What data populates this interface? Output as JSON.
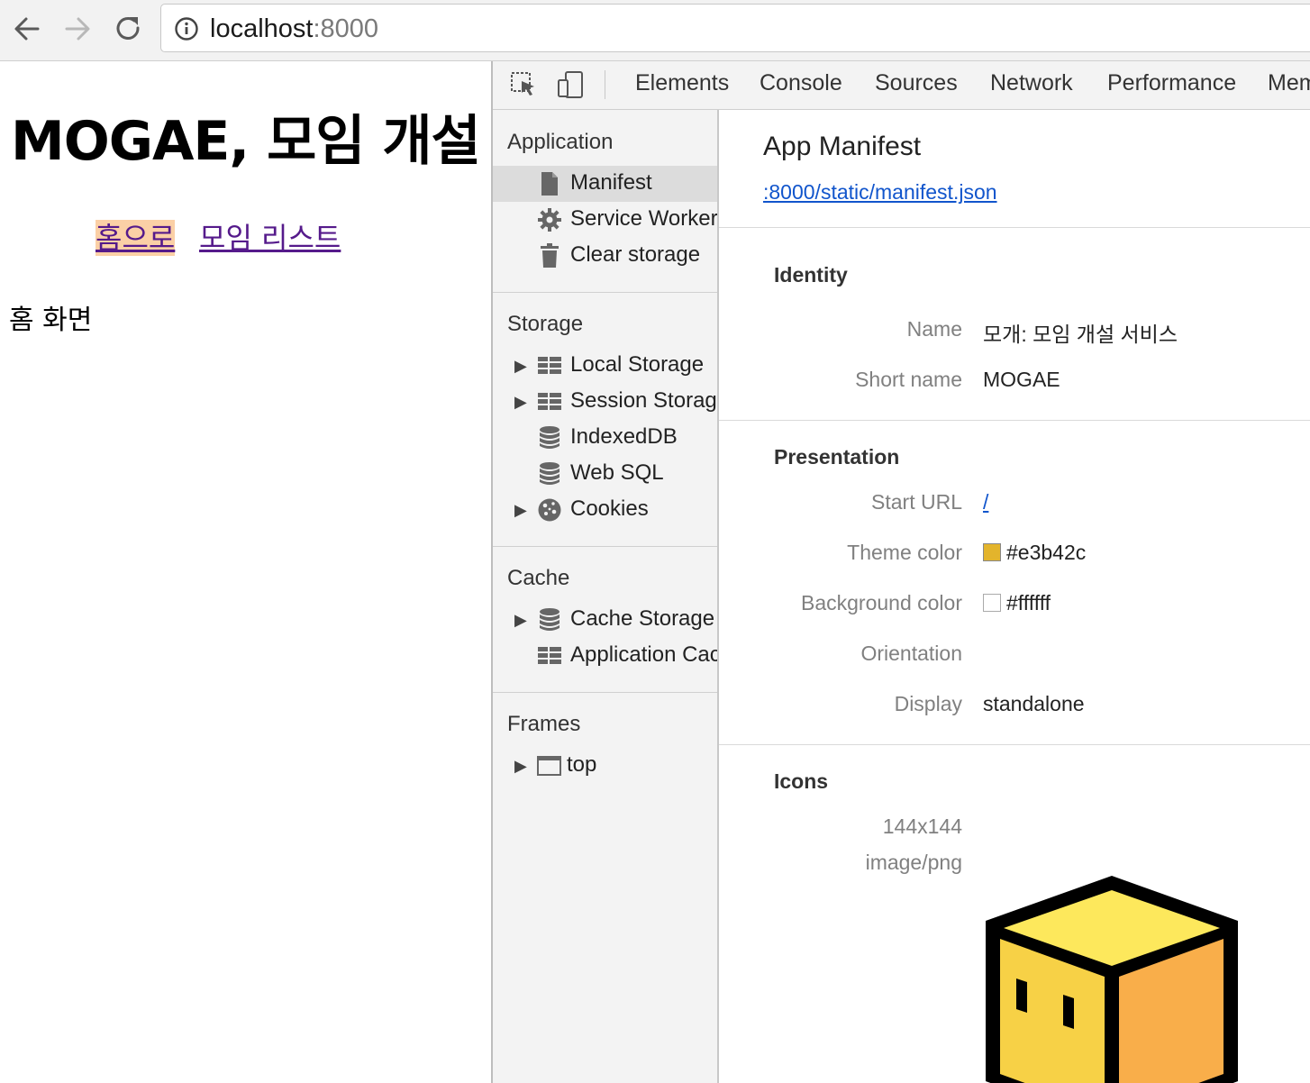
{
  "browser": {
    "url_host": "localhost",
    "url_port": ":8000"
  },
  "page": {
    "title": "MOGAE, 모임 개설",
    "links": [
      "홈으로",
      "모임 리스트"
    ],
    "body_text": "홈 화면"
  },
  "devtools": {
    "tabs": [
      "Elements",
      "Console",
      "Sources",
      "Network",
      "Performance",
      "Mem"
    ],
    "sidebar": {
      "application": {
        "title": "Application",
        "items": [
          "Manifest",
          "Service Workers",
          "Clear storage"
        ]
      },
      "storage": {
        "title": "Storage",
        "items": [
          "Local Storage",
          "Session Storage",
          "IndexedDB",
          "Web SQL",
          "Cookies"
        ]
      },
      "cache": {
        "title": "Cache",
        "items": [
          "Cache Storage",
          "Application Cache"
        ]
      },
      "frames": {
        "title": "Frames",
        "items": [
          "top"
        ]
      }
    },
    "manifest": {
      "title": "App Manifest",
      "link": ":8000/static/manifest.json",
      "identity": {
        "title": "Identity",
        "name_label": "Name",
        "name_value": "모개: 모임 개설 서비스",
        "short_name_label": "Short name",
        "short_name_value": "MOGAE"
      },
      "presentation": {
        "title": "Presentation",
        "start_url_label": "Start URL",
        "start_url_value": "/",
        "theme_color_label": "Theme color",
        "theme_color_value": "#e3b42c",
        "background_color_label": "Background color",
        "background_color_value": "#ffffff",
        "orientation_label": "Orientation",
        "display_label": "Display",
        "display_value": "standalone"
      },
      "icons": {
        "title": "Icons",
        "size": "144x144",
        "type": "image/png"
      }
    }
  },
  "colors": {
    "theme_swatch": "#e3b42c",
    "background_swatch": "#ffffff",
    "link_visited": "#551a8b",
    "link_highlight": "#fbd0a6"
  }
}
